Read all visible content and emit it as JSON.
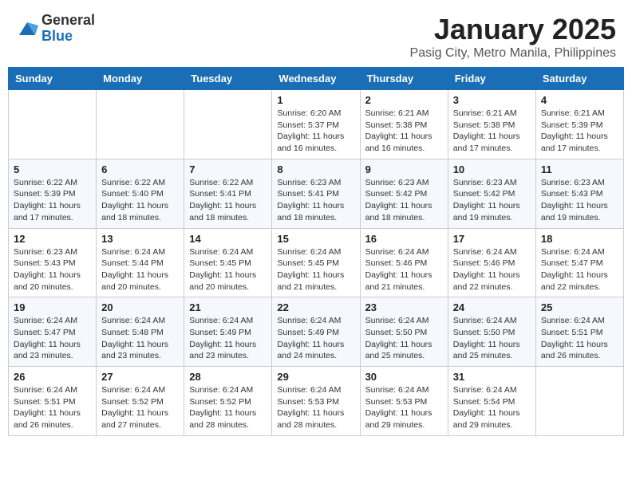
{
  "header": {
    "logo_general": "General",
    "logo_blue": "Blue",
    "month_title": "January 2025",
    "location": "Pasig City, Metro Manila, Philippines"
  },
  "days_of_week": [
    "Sunday",
    "Monday",
    "Tuesday",
    "Wednesday",
    "Thursday",
    "Friday",
    "Saturday"
  ],
  "weeks": [
    [
      {
        "day": "",
        "info": ""
      },
      {
        "day": "",
        "info": ""
      },
      {
        "day": "",
        "info": ""
      },
      {
        "day": "1",
        "info": "Sunrise: 6:20 AM\nSunset: 5:37 PM\nDaylight: 11 hours\nand 16 minutes."
      },
      {
        "day": "2",
        "info": "Sunrise: 6:21 AM\nSunset: 5:38 PM\nDaylight: 11 hours\nand 16 minutes."
      },
      {
        "day": "3",
        "info": "Sunrise: 6:21 AM\nSunset: 5:38 PM\nDaylight: 11 hours\nand 17 minutes."
      },
      {
        "day": "4",
        "info": "Sunrise: 6:21 AM\nSunset: 5:39 PM\nDaylight: 11 hours\nand 17 minutes."
      }
    ],
    [
      {
        "day": "5",
        "info": "Sunrise: 6:22 AM\nSunset: 5:39 PM\nDaylight: 11 hours\nand 17 minutes."
      },
      {
        "day": "6",
        "info": "Sunrise: 6:22 AM\nSunset: 5:40 PM\nDaylight: 11 hours\nand 18 minutes."
      },
      {
        "day": "7",
        "info": "Sunrise: 6:22 AM\nSunset: 5:41 PM\nDaylight: 11 hours\nand 18 minutes."
      },
      {
        "day": "8",
        "info": "Sunrise: 6:23 AM\nSunset: 5:41 PM\nDaylight: 11 hours\nand 18 minutes."
      },
      {
        "day": "9",
        "info": "Sunrise: 6:23 AM\nSunset: 5:42 PM\nDaylight: 11 hours\nand 18 minutes."
      },
      {
        "day": "10",
        "info": "Sunrise: 6:23 AM\nSunset: 5:42 PM\nDaylight: 11 hours\nand 19 minutes."
      },
      {
        "day": "11",
        "info": "Sunrise: 6:23 AM\nSunset: 5:43 PM\nDaylight: 11 hours\nand 19 minutes."
      }
    ],
    [
      {
        "day": "12",
        "info": "Sunrise: 6:23 AM\nSunset: 5:43 PM\nDaylight: 11 hours\nand 20 minutes."
      },
      {
        "day": "13",
        "info": "Sunrise: 6:24 AM\nSunset: 5:44 PM\nDaylight: 11 hours\nand 20 minutes."
      },
      {
        "day": "14",
        "info": "Sunrise: 6:24 AM\nSunset: 5:45 PM\nDaylight: 11 hours\nand 20 minutes."
      },
      {
        "day": "15",
        "info": "Sunrise: 6:24 AM\nSunset: 5:45 PM\nDaylight: 11 hours\nand 21 minutes."
      },
      {
        "day": "16",
        "info": "Sunrise: 6:24 AM\nSunset: 5:46 PM\nDaylight: 11 hours\nand 21 minutes."
      },
      {
        "day": "17",
        "info": "Sunrise: 6:24 AM\nSunset: 5:46 PM\nDaylight: 11 hours\nand 22 minutes."
      },
      {
        "day": "18",
        "info": "Sunrise: 6:24 AM\nSunset: 5:47 PM\nDaylight: 11 hours\nand 22 minutes."
      }
    ],
    [
      {
        "day": "19",
        "info": "Sunrise: 6:24 AM\nSunset: 5:47 PM\nDaylight: 11 hours\nand 23 minutes."
      },
      {
        "day": "20",
        "info": "Sunrise: 6:24 AM\nSunset: 5:48 PM\nDaylight: 11 hours\nand 23 minutes."
      },
      {
        "day": "21",
        "info": "Sunrise: 6:24 AM\nSunset: 5:49 PM\nDaylight: 11 hours\nand 23 minutes."
      },
      {
        "day": "22",
        "info": "Sunrise: 6:24 AM\nSunset: 5:49 PM\nDaylight: 11 hours\nand 24 minutes."
      },
      {
        "day": "23",
        "info": "Sunrise: 6:24 AM\nSunset: 5:50 PM\nDaylight: 11 hours\nand 25 minutes."
      },
      {
        "day": "24",
        "info": "Sunrise: 6:24 AM\nSunset: 5:50 PM\nDaylight: 11 hours\nand 25 minutes."
      },
      {
        "day": "25",
        "info": "Sunrise: 6:24 AM\nSunset: 5:51 PM\nDaylight: 11 hours\nand 26 minutes."
      }
    ],
    [
      {
        "day": "26",
        "info": "Sunrise: 6:24 AM\nSunset: 5:51 PM\nDaylight: 11 hours\nand 26 minutes."
      },
      {
        "day": "27",
        "info": "Sunrise: 6:24 AM\nSunset: 5:52 PM\nDaylight: 11 hours\nand 27 minutes."
      },
      {
        "day": "28",
        "info": "Sunrise: 6:24 AM\nSunset: 5:52 PM\nDaylight: 11 hours\nand 28 minutes."
      },
      {
        "day": "29",
        "info": "Sunrise: 6:24 AM\nSunset: 5:53 PM\nDaylight: 11 hours\nand 28 minutes."
      },
      {
        "day": "30",
        "info": "Sunrise: 6:24 AM\nSunset: 5:53 PM\nDaylight: 11 hours\nand 29 minutes."
      },
      {
        "day": "31",
        "info": "Sunrise: 6:24 AM\nSunset: 5:54 PM\nDaylight: 11 hours\nand 29 minutes."
      },
      {
        "day": "",
        "info": ""
      }
    ]
  ]
}
